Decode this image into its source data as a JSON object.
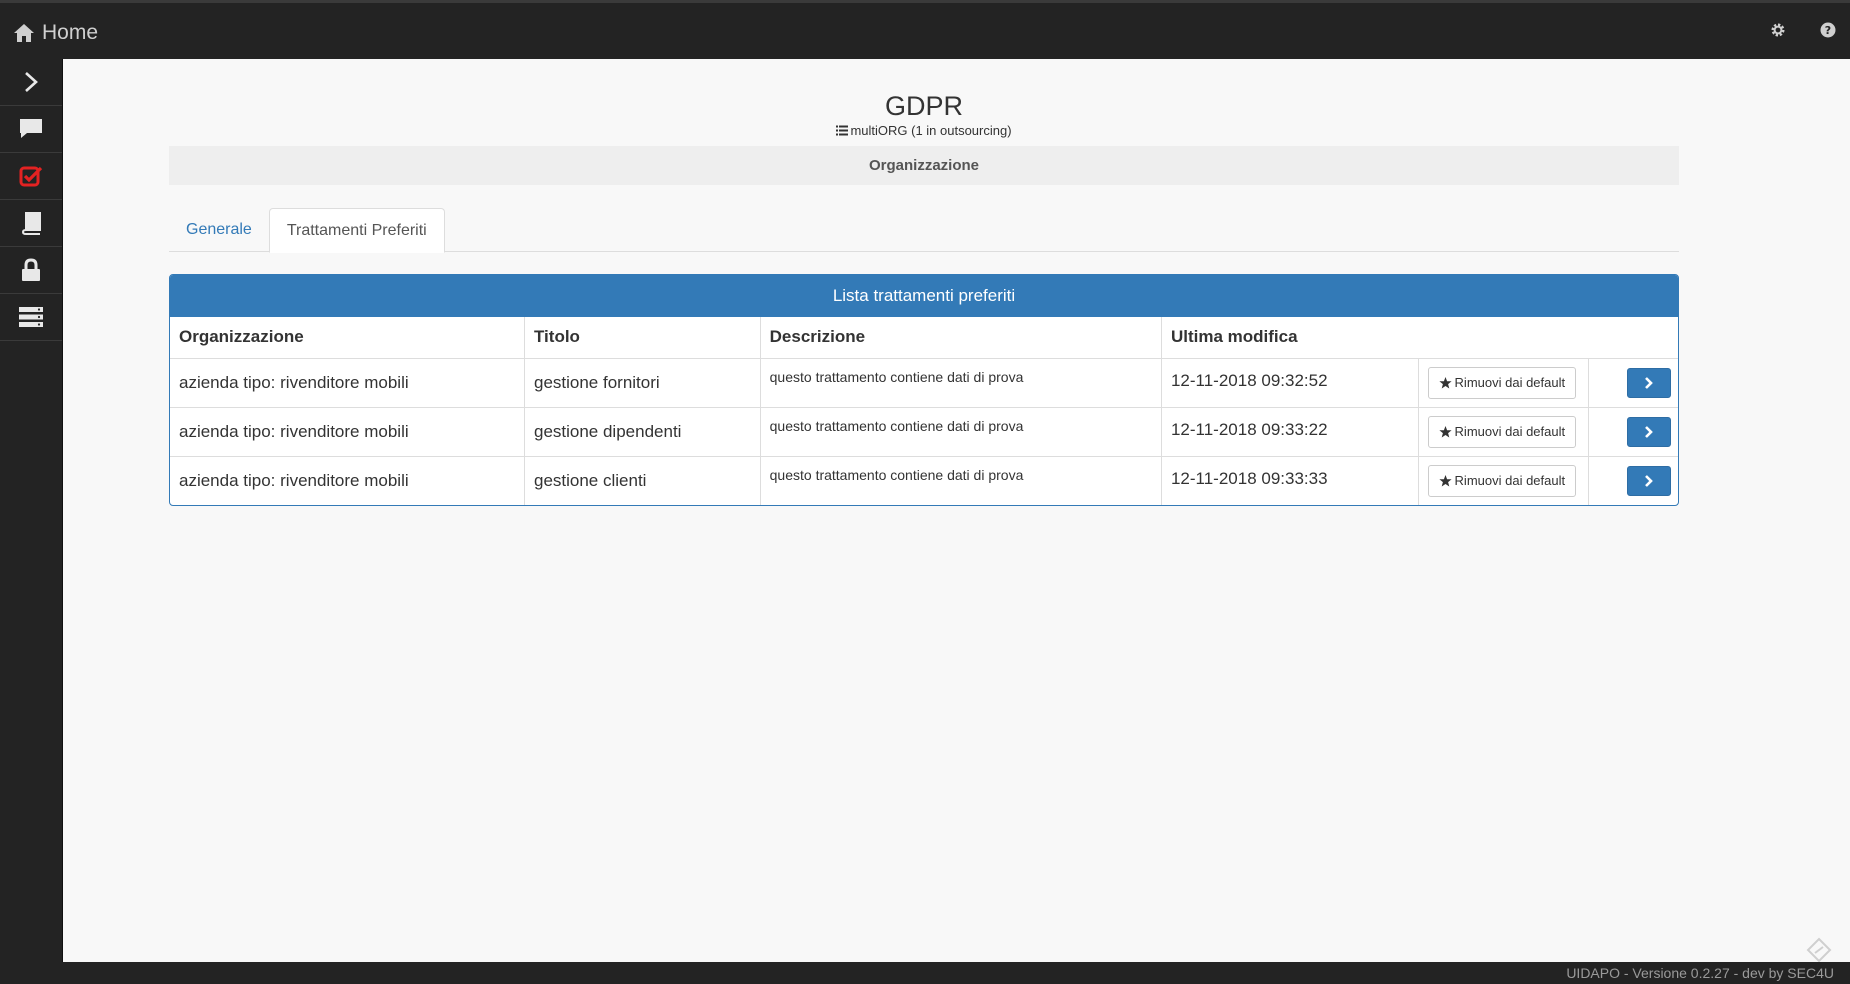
{
  "topbar": {
    "home_label": "Home",
    "icons": [
      "home-icon",
      "gear-icon",
      "help-icon"
    ]
  },
  "sidebar": {
    "items": [
      "chevron-right-icon",
      "comment-icon",
      "checkbox-icon",
      "book-icon",
      "lock-icon",
      "server-icon"
    ],
    "accent": "#e32222"
  },
  "header": {
    "title": "GDPR",
    "subtitle": "multiORG (1 in outsourcing)"
  },
  "org_strip": {
    "label": "Organizzazione"
  },
  "tabs": [
    {
      "label": "Generale"
    },
    {
      "label": "Trattamenti Preferiti"
    }
  ],
  "panel": {
    "title": "Lista trattamenti preferiti",
    "columns": [
      "Organizzazione",
      "Titolo",
      "Descrizione",
      "Ultima modifica"
    ],
    "rows": [
      {
        "organizzazione": "azienda tipo: rivenditore mobili",
        "titolo": "gestione fornitori",
        "descrizione": "questo trattamento contiene dati di prova",
        "ultima_modifica": "12-11-2018 09:32:52",
        "action_label": "Rimuovi dai default"
      },
      {
        "organizzazione": "azienda tipo: rivenditore mobili",
        "titolo": "gestione dipendenti",
        "descrizione": "questo trattamento contiene dati di prova",
        "ultima_modifica": "12-11-2018 09:33:22",
        "action_label": "Rimuovi dai default"
      },
      {
        "organizzazione": "azienda tipo: rivenditore mobili",
        "titolo": "gestione clienti",
        "descrizione": "questo trattamento contiene dati di prova",
        "ultima_modifica": "12-11-2018 09:33:33",
        "action_label": "Rimuovi dai default"
      }
    ]
  },
  "footer": {
    "text": "UIDAPO - Versione 0.2.27 - dev by SEC4U"
  },
  "colors": {
    "primary": "#337ab7",
    "dark": "#232323",
    "background": "#f8f8f8"
  }
}
